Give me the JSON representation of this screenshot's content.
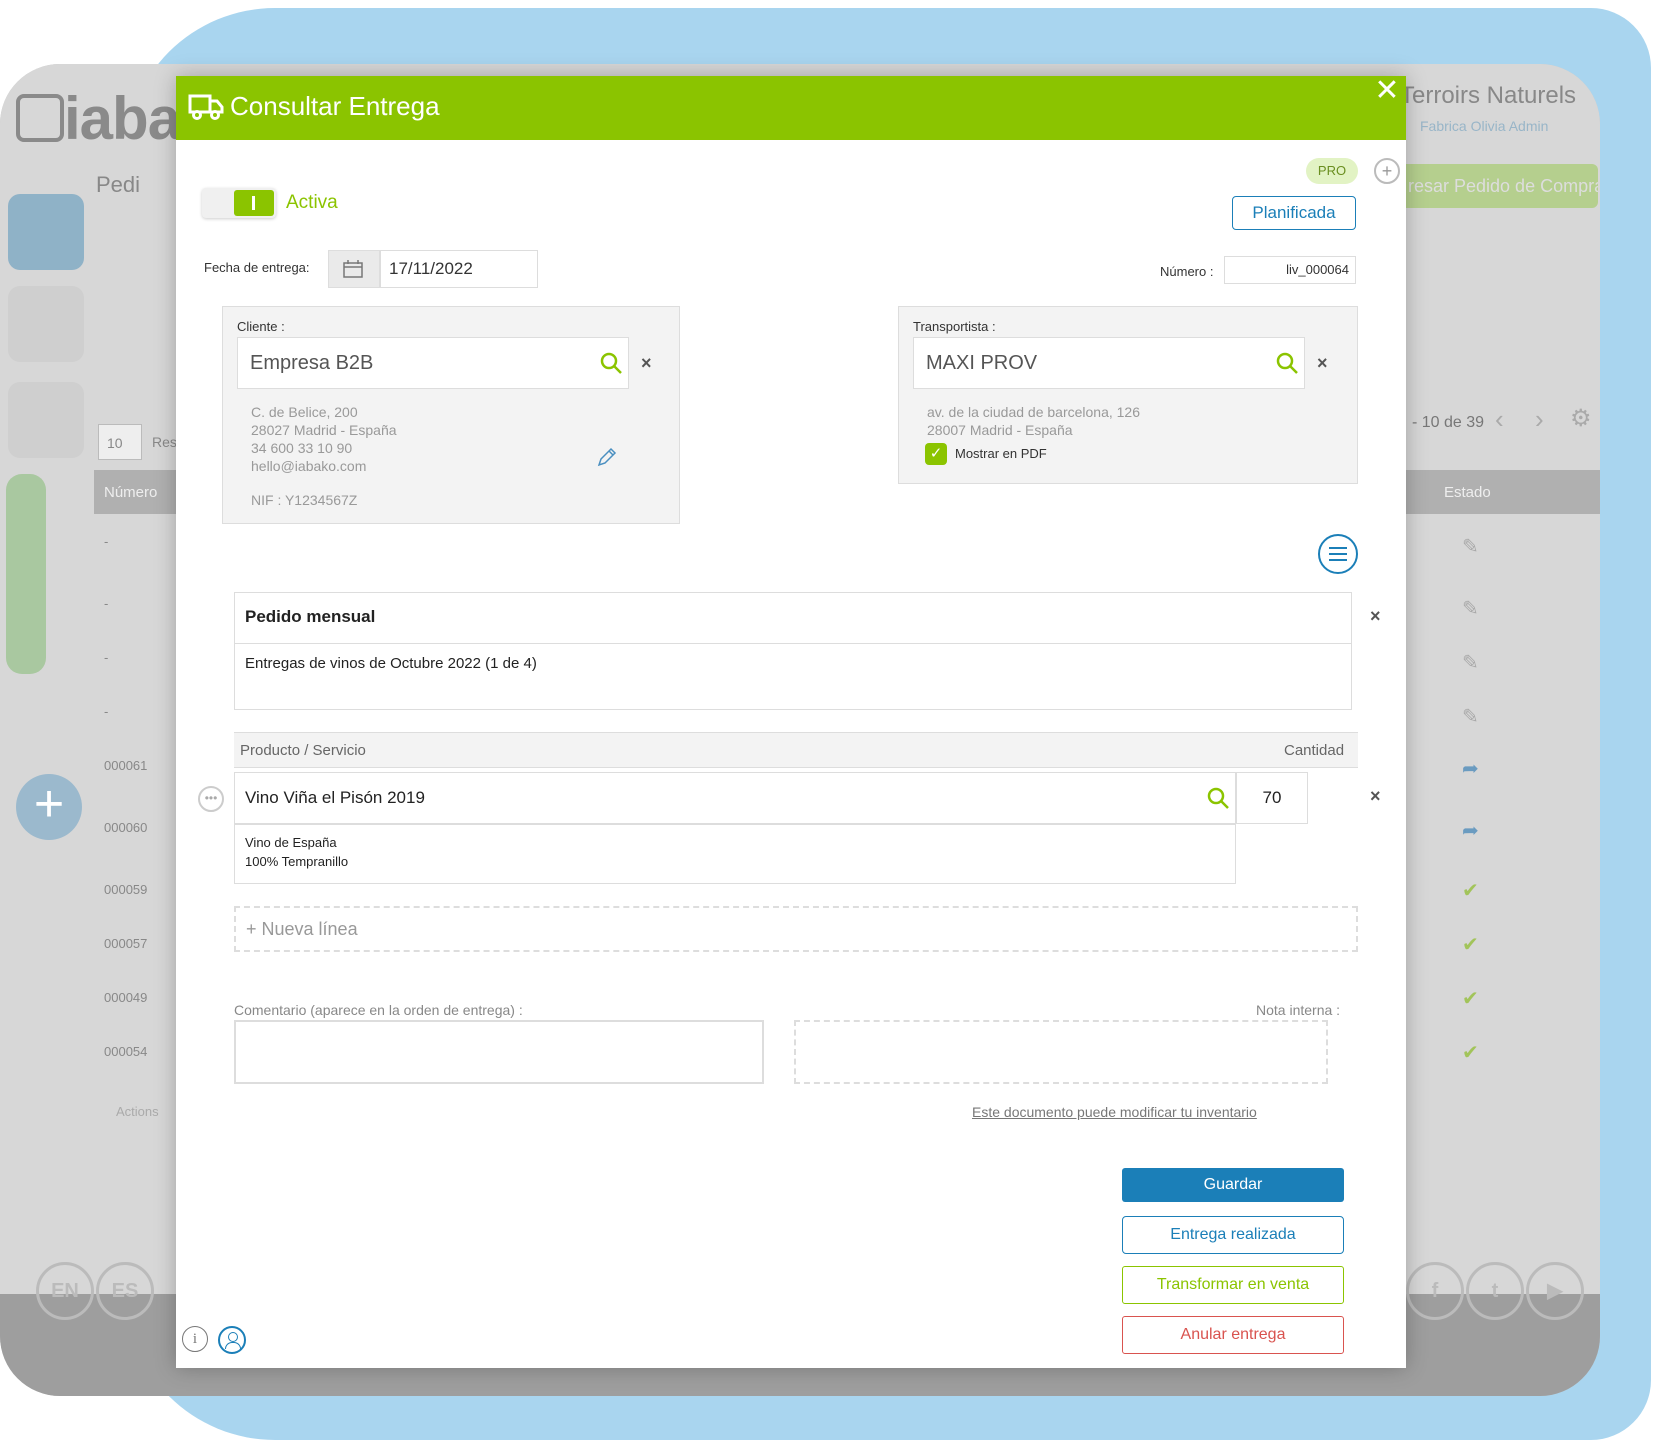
{
  "background": {
    "logo_text": "iaba",
    "pedido_label": "Pedi",
    "company_name": "Terroirs Naturels",
    "company_sub": "Fabrica Olivia Admin",
    "ingresar_button": "resar Pedido de Compra",
    "rows_per_page": "10",
    "rows_label": "Res",
    "page_info": "- 10 de 39",
    "table_header_numero": "Número",
    "table_header_estado": "Estado",
    "rows": [
      {
        "numero": "-",
        "status": "edit"
      },
      {
        "numero": "-",
        "status": "edit"
      },
      {
        "numero": "-",
        "status": "edit"
      },
      {
        "numero": "-",
        "status": "edit"
      },
      {
        "numero": "000061",
        "status": "share"
      },
      {
        "numero": "000060",
        "status": "share"
      },
      {
        "numero": "000059",
        "status": "check"
      },
      {
        "numero": "000057",
        "status": "check"
      },
      {
        "numero": "000049",
        "status": "check"
      },
      {
        "numero": "000054",
        "status": "check"
      }
    ],
    "actions_label": "Actions",
    "lang_en": "EN",
    "lang_es": "ES"
  },
  "modal": {
    "title": "Consultar Entrega",
    "toggle_label": "Activa",
    "pro_badge": "PRO",
    "status_button": "Planificada",
    "fecha_label": "Fecha de entrega:",
    "fecha_value": "17/11/2022",
    "numero_label": "Número :",
    "numero_value": "liv_000064",
    "cliente": {
      "label": "Cliente :",
      "value": "Empresa B2B",
      "address1": "C. de Belice, 200",
      "address2": "28027 Madrid - España",
      "phone": "34 600 33 10 90",
      "email": "hello@iabako.com",
      "nif": "NIF : Y1234567Z"
    },
    "transportista": {
      "label": "Transportista :",
      "value": "MAXI PROV",
      "address1": "av. de la ciudad de barcelona, 126",
      "address2": "28007 Madrid - España",
      "checkbox_label": "Mostrar en PDF",
      "checked": true
    },
    "pedido_title": "Pedido mensual",
    "pedido_description": "Entregas de vinos de Octubre 2022 (1 de 4)",
    "table": {
      "col_product": "Producto / Servicio",
      "col_quantity": "Cantidad",
      "lines": [
        {
          "product": "Vino Viña el Pisón 2019",
          "quantity": "70",
          "desc1": "Vino de España",
          "desc2": "100% Tempranillo"
        }
      ],
      "new_line": "+ Nueva línea"
    },
    "comentario_label": "Comentario (aparece en la orden de entrega) :",
    "nota_label": "Nota interna :",
    "inventory_link": "Este documento puede modificar tu inventario",
    "buttons": {
      "guardar": "Guardar",
      "entrega_realizada": "Entrega realizada",
      "transformar": "Transformar en venta",
      "anular": "Anular entrega"
    },
    "colors": {
      "header_green": "#8bc400",
      "primary_blue": "#1b7fb8",
      "accent_green": "#8bc400",
      "danger_red": "#d9534f"
    }
  }
}
